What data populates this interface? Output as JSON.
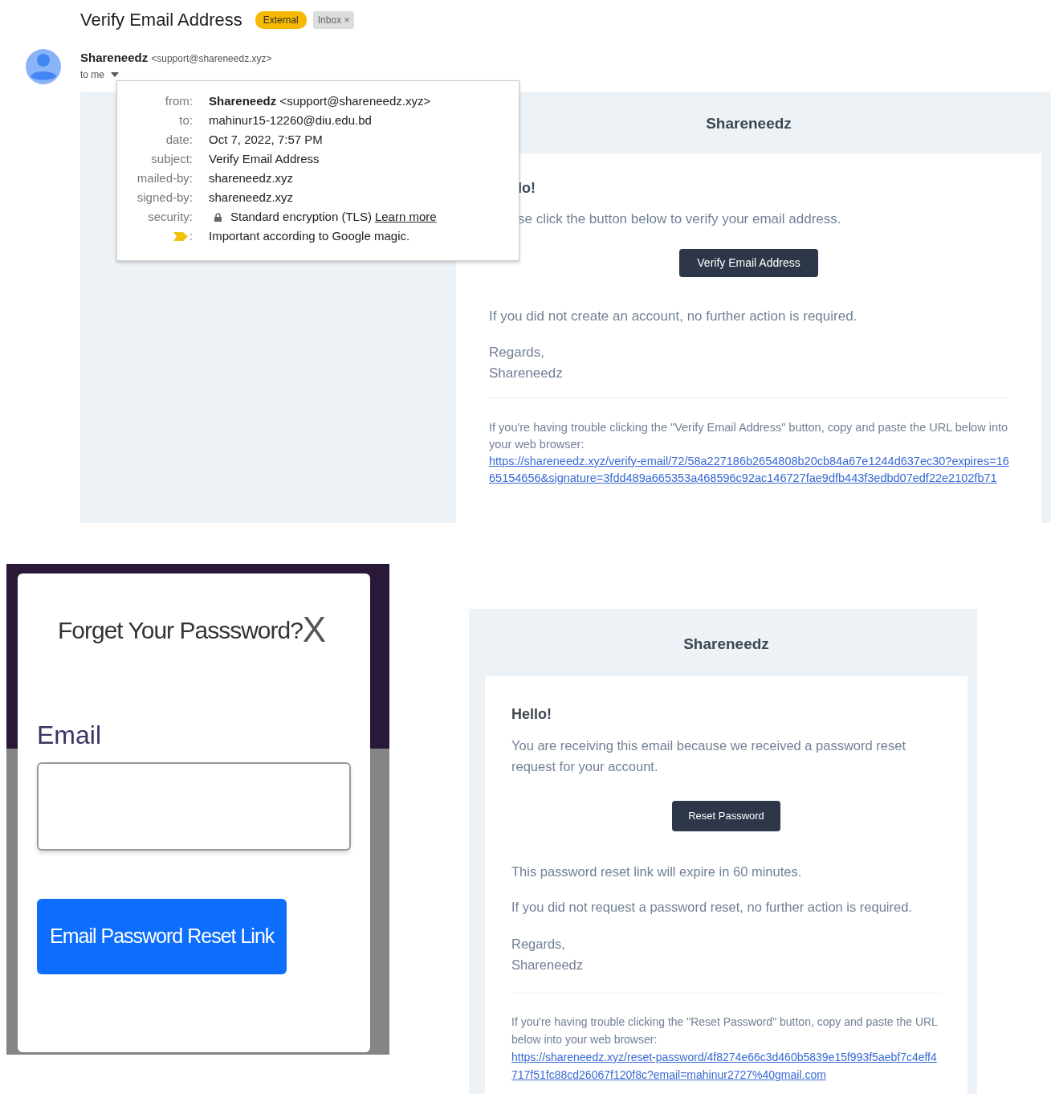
{
  "email_view": {
    "subject": "Verify Email Address",
    "labels": [
      {
        "text": "External",
        "kind": "external"
      },
      {
        "text": "Inbox",
        "kind": "folder",
        "close": "×"
      }
    ],
    "sender": {
      "name": "Shareneedz",
      "address": "<support@shareneedz.xyz>",
      "recipient": "to me"
    },
    "details_popup": {
      "rows": [
        {
          "kind": "text",
          "label": "from:",
          "value": "**Shareneedz** <support@shareneedz.xyz>"
        },
        {
          "kind": "text",
          "label": "to:",
          "value": "mahinur15-12260@diu.edu.bd"
        },
        {
          "kind": "text",
          "label": "date:",
          "value": "Oct 7, 2022, 7:57 PM"
        },
        {
          "kind": "text",
          "label": "subject:",
          "value": "Verify Email Address"
        },
        {
          "kind": "text",
          "label": "mailed-by:",
          "value": "shareneedz.xyz"
        },
        {
          "kind": "text",
          "label": "signed-by:",
          "value": "shareneedz.xyz"
        },
        {
          "kind": "security",
          "label": "security:",
          "value": "Standard encryption (TLS)",
          "link": "Learn more"
        },
        {
          "kind": "importance",
          "label": ":",
          "value": "Important according to Google magic."
        }
      ]
    },
    "message": {
      "brand": "Shareneedz",
      "greeting": "lo!",
      "intro": "se click the button below to verify your email address.",
      "button": "Verify Email Address",
      "outro": "If you did not create an account, no further action is required.",
      "regards": [
        "Regards,",
        "Shareneedz"
      ],
      "trouble_text": "If you're having trouble clicking the \"Verify Email Address\" button, copy and paste the URL below into your web browser:",
      "url": "https://shareneedz.xyz/verify-email/72/58a227186b2654808b20cb84a67e1244d637ec30?expires=1665154656&signature=3fdd489a665353a468596c92ac146727fae9dfb443f3edbd07edf22e2102fb71"
    }
  },
  "reset_modal": {
    "title": "Forget Your Passsword?",
    "close": "X",
    "email_label": "Email",
    "button": "Email Password Reset Link"
  },
  "reset_email": {
    "brand": "Shareneedz",
    "greeting": "Hello!",
    "lines": [
      "You are receiving this email because we received a password reset request for your account."
    ],
    "button": "Reset Password",
    "outro": [
      "This password reset link will expire in 60 minutes.",
      "If you did not request a password reset, no further action is required."
    ],
    "regards": [
      "Regards,",
      "Shareneedz"
    ],
    "trouble_text": "If you're having trouble clicking the \"Reset Password\" button, copy and paste the URL below into your web browser:",
    "url": "https://shareneedz.xyz/reset-password/4f8274e66c3d460b5839e15f993f5aebf7c4eff4717f51fc88cd26067f120f8c?email=mahinur2727%40gmail.com"
  }
}
